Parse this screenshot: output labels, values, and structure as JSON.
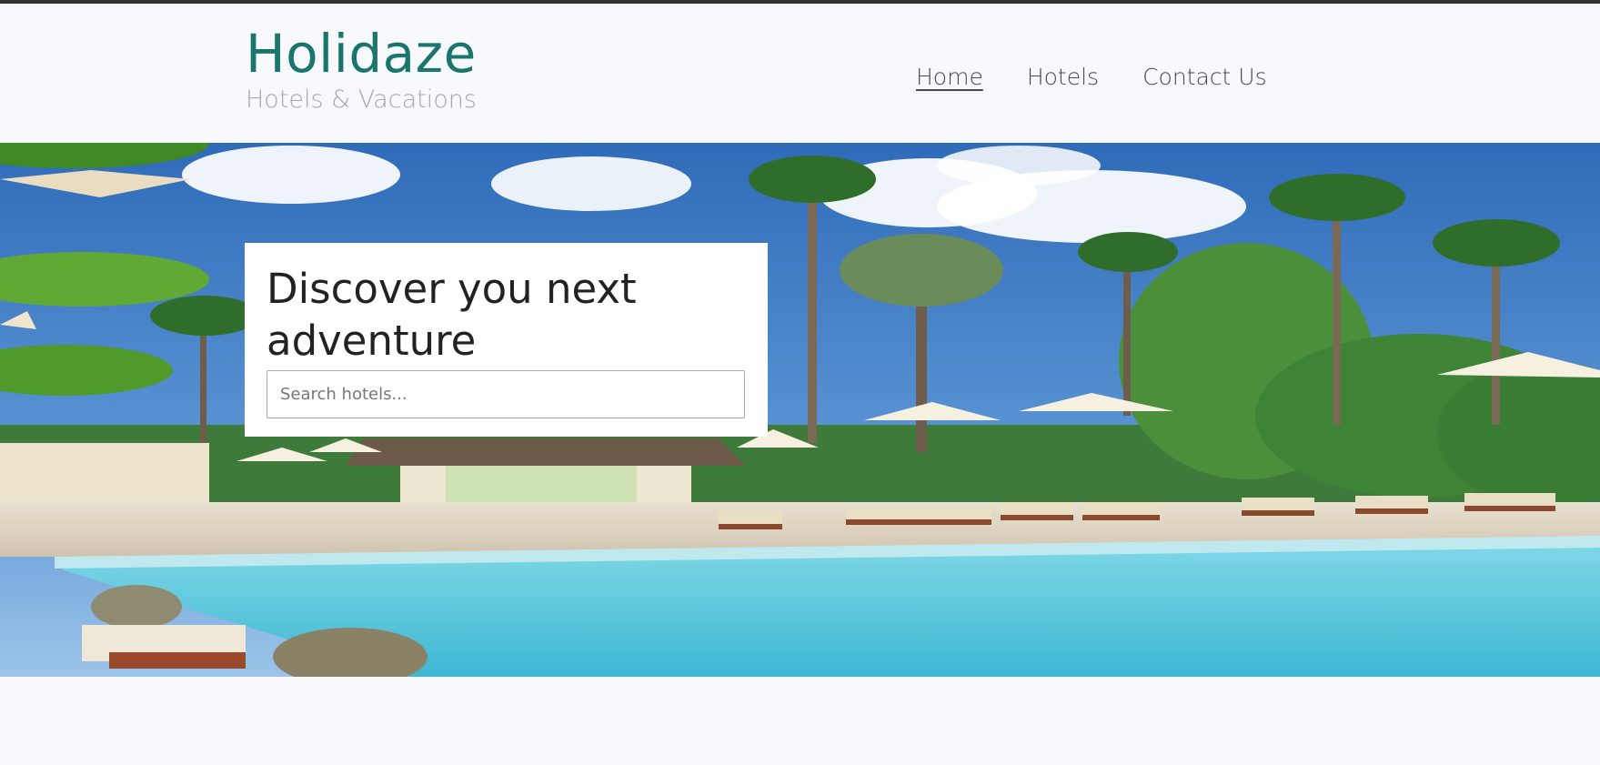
{
  "brand": {
    "title": "Holidaze",
    "subtitle": "Hotels & Vacations"
  },
  "nav": {
    "items": [
      {
        "label": "Home",
        "active": true
      },
      {
        "label": "Hotels",
        "active": false
      },
      {
        "label": "Contact Us",
        "active": false
      }
    ]
  },
  "hero": {
    "heading": "Discover you next adventure",
    "search_placeholder": "Search hotels...",
    "image": "tropical-resort-pool-photo"
  },
  "colors": {
    "brand": "#1a756f",
    "subtitle": "#a8a8a8",
    "nav_text": "#4a4a4a",
    "page_bg": "#f8f9fc"
  }
}
